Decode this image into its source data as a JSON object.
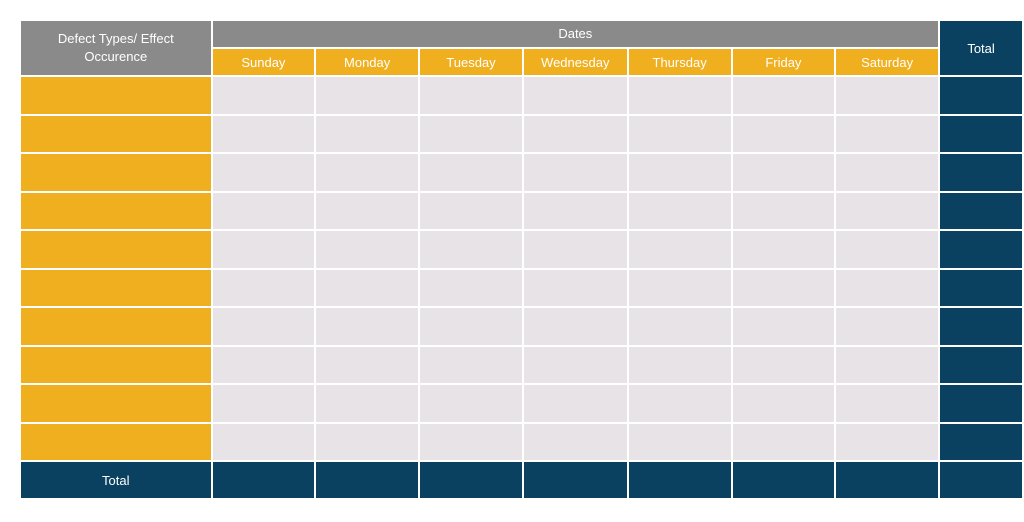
{
  "table": {
    "corner_label": "Defect Types/ Effect Occurence",
    "dates_label": "Dates",
    "total_header": "Total",
    "days": [
      "Sunday",
      "Monday",
      "Tuesday",
      "Wednesday",
      "Thursday",
      "Friday",
      "Saturday"
    ],
    "row_count": 10,
    "footer_label": "Total",
    "colors": {
      "header_gray": "#8a8a8a",
      "accent_yellow": "#f0af1f",
      "navy": "#0b4160",
      "cell_fill": "#e7e3e6"
    }
  }
}
